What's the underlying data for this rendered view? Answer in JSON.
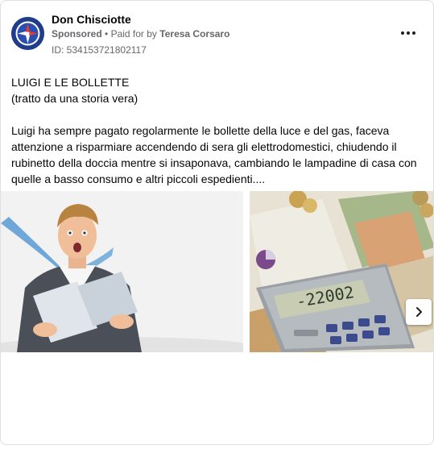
{
  "advertiser": {
    "name": "Don Chisciotte",
    "sponsored_label": "Sponsored",
    "separator": "•",
    "paid_for_prefix": "Paid for by",
    "payer": "Teresa Corsaro",
    "ad_id": "ID: 534153721802117"
  },
  "post": {
    "title": "LUIGI E LE BOLLETTE",
    "subtitle": "(tratto da una storia vera)",
    "body": "Luigi ha sempre pagato regolarmente le bollette della luce e del gas, faceva attenzione a risparmiare accendendo di sera gli elettrodomestici, chiudendo il rubinetto della doccia mentre si insaponava, cambiando le lampadine di casa con quelle a basso consumo e altri piccoli espedienti...."
  },
  "carousel": {
    "calculator_display": "-22002"
  },
  "icons": {
    "more": "more-horizontal-icon",
    "next": "chevron-right-icon",
    "avatar": "compass-logo"
  },
  "colors": {
    "avatar_bg": "#1f3d8a",
    "secondary_text": "#65676b",
    "primary_text": "#050505"
  }
}
